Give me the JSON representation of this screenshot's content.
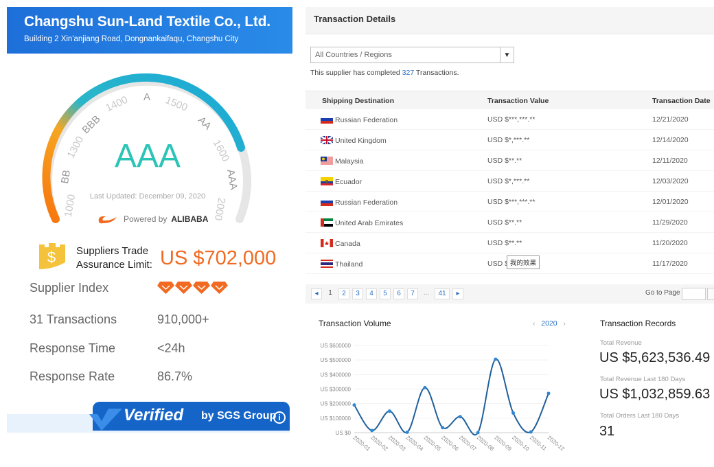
{
  "company": {
    "name": "Changshu Sun-Land Textile Co., Ltd.",
    "address": "Building 2 Xin'anjiang Road, Dongnankaifaqu, Changshu City"
  },
  "gauge": {
    "rating": "AAA",
    "last_updated": "Last Updated: December 09, 2020",
    "powered_prefix": "Powered by",
    "powered_brand": "ALIBABA",
    "score_fraction": 0.82,
    "labels": [
      "1000",
      "BB",
      "1300",
      "BBB",
      "1400",
      "A",
      "1500",
      "AA",
      "1600",
      "AAA",
      "2000"
    ],
    "colors": {
      "orange": "#f7760f",
      "blue": "#1aa8d8",
      "track": "#e6e6e6",
      "rating": "#2cc4b6"
    }
  },
  "assurance": {
    "label_line1": "Suppliers Trade",
    "label_line2": "Assurance Limit:",
    "value": "US $702,000",
    "color": "#f26a21"
  },
  "stats": [
    {
      "label": "Supplier Index",
      "value": "",
      "diamonds": 4
    },
    {
      "label": "31 Transactions",
      "value": "910,000+"
    },
    {
      "label": "Response Time",
      "value": "<24h"
    },
    {
      "label": "Response Rate",
      "value": "86.7%"
    }
  ],
  "verified": {
    "word": "Verified",
    "by": "by SGS Group"
  },
  "transactions": {
    "title": "Transaction Details",
    "filter": "All Countries / Regions",
    "completed_prefix": "This supplier has completed",
    "completed_count": "327",
    "completed_suffix": "Transactions.",
    "columns": [
      "Shipping Destination",
      "Transaction Value",
      "Transaction Date"
    ],
    "rows": [
      {
        "country": "Russian Federation",
        "flag": "ru",
        "value": "USD $***,***.**",
        "date": "12/21/2020"
      },
      {
        "country": "United Kingdom",
        "flag": "gb",
        "value": "USD $*,***.**",
        "date": "12/14/2020"
      },
      {
        "country": "Malaysia",
        "flag": "my",
        "value": "USD $**.**",
        "date": "12/11/2020"
      },
      {
        "country": "Ecuador",
        "flag": "ec",
        "value": "USD $*,***.**",
        "date": "12/03/2020"
      },
      {
        "country": "Russian Federation",
        "flag": "ru",
        "value": "USD $***,***.**",
        "date": "12/01/2020"
      },
      {
        "country": "United Arab Emirates",
        "flag": "ae",
        "value": "USD $**.**",
        "date": "11/29/2020"
      },
      {
        "country": "Canada",
        "flag": "ca",
        "value": "USD $**.**",
        "date": "11/20/2020"
      },
      {
        "country": "Thailand",
        "flag": "th",
        "value": "USD $",
        "date": "11/17/2020"
      }
    ],
    "tooltip": "我的效果",
    "pager": {
      "pages": [
        "1",
        "2",
        "3",
        "4",
        "5",
        "6",
        "7",
        "...",
        "41"
      ],
      "current": "1",
      "goto_label": "Go to Page"
    }
  },
  "volume": {
    "title": "Transaction Volume",
    "year": "2020",
    "prev": "‹",
    "next": "›"
  },
  "records": {
    "title": "Transaction Records",
    "items": [
      {
        "label": "Total Revenue",
        "value": "US $5,623,536.49"
      },
      {
        "label": "Total Revenue Last 180 Days",
        "value": "US $1,032,859.63"
      },
      {
        "label": "Total Orders Last 180 Days",
        "value": "31"
      }
    ]
  },
  "chart_data": {
    "type": "line",
    "title": "Transaction Volume",
    "xlabel": "",
    "ylabel": "",
    "categories": [
      "2020-01",
      "2020-02",
      "2020-03",
      "2020-04",
      "2020-05",
      "2020-06",
      "2020-07",
      "2020-08",
      "2020-09",
      "2020-10",
      "2020-11",
      "2020-12"
    ],
    "values": [
      190000,
      15000,
      148000,
      3000,
      310000,
      35000,
      110000,
      0,
      505000,
      135000,
      5000,
      270000
    ],
    "yticks": [
      "US $0",
      "US $100000",
      "US $200000",
      "US $300000",
      "US $400000",
      "US $500000",
      "US $600000"
    ],
    "ylim": [
      0,
      600000
    ],
    "grid": true,
    "color": "#2d87d6"
  }
}
